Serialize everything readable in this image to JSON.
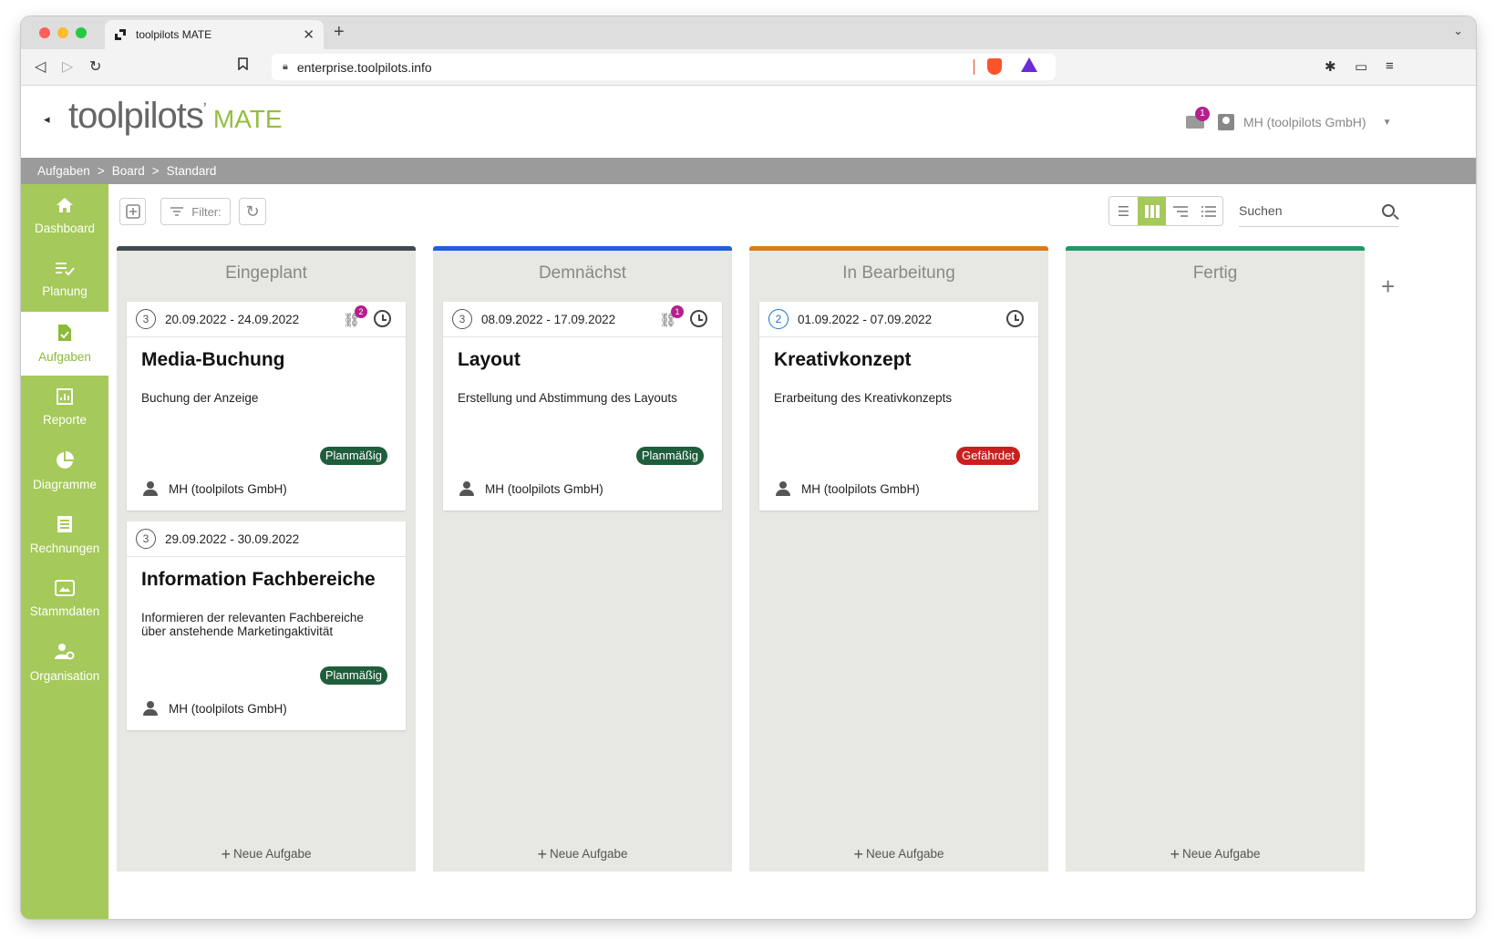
{
  "browser": {
    "tab_title": "toolpilots MATE",
    "url": "enterprise.toolpilots.info"
  },
  "app": {
    "logo_text": "toolpilots",
    "logo_sup": "ʼ",
    "logo_mate": "MATE",
    "mail_count": "1",
    "user_name": "MH (toolpilots GmbH)"
  },
  "breadcrumb": [
    "Aufgaben",
    "Board",
    "Standard"
  ],
  "sidebar": {
    "items": [
      {
        "label": "Dashboard"
      },
      {
        "label": "Planung"
      },
      {
        "label": "Aufgaben"
      },
      {
        "label": "Reporte"
      },
      {
        "label": "Diagramme"
      },
      {
        "label": "Rechnungen"
      },
      {
        "label": "Stammdaten"
      },
      {
        "label": "Organisation"
      }
    ]
  },
  "toolbar": {
    "filter_label": "Filter:",
    "search_placeholder": "Suchen"
  },
  "colors": {
    "brand_green": "#a5c95a",
    "planned": "#414a52",
    "soon": "#1f5fe0",
    "in_progress": "#de7a1a",
    "done": "#1e9a6a",
    "status_ok": "#1f5e3b",
    "status_risk": "#c8201f"
  },
  "columns": [
    {
      "title": "Eingeplant",
      "new_task": "Neue Aufgabe",
      "cards": [
        {
          "number": "3",
          "dates": "20.09.2022 - 24.09.2022",
          "link_count": "2",
          "title": "Media-Buchung",
          "description": "Buchung der Anzeige",
          "status": "Planmäßig",
          "owner": "MH (toolpilots GmbH)"
        },
        {
          "number": "3",
          "dates": "29.09.2022 - 30.09.2022",
          "title": "Information Fachbereiche",
          "description": "Informieren der relevanten Fachbereiche über anstehende Marketingaktivität",
          "status": "Planmäßig",
          "owner": "MH (toolpilots GmbH)"
        }
      ]
    },
    {
      "title": "Demnächst",
      "new_task": "Neue Aufgabe",
      "cards": [
        {
          "number": "3",
          "dates": "08.09.2022 - 17.09.2022",
          "link_count": "1",
          "title": "Layout",
          "description": "Erstellung und Abstimmung des Layouts",
          "status": "Planmäßig",
          "owner": "MH (toolpilots GmbH)"
        }
      ]
    },
    {
      "title": "In Bearbeitung",
      "new_task": "Neue Aufgabe",
      "cards": [
        {
          "number": "2",
          "dates": "01.09.2022 - 07.09.2022",
          "title": "Kreativkonzept",
          "description": "Erarbeitung des Kreativkonzepts",
          "status": "Gefährdet",
          "owner": "MH (toolpilots GmbH)"
        }
      ]
    },
    {
      "title": "Fertig",
      "new_task": "Neue Aufgabe",
      "cards": []
    }
  ]
}
